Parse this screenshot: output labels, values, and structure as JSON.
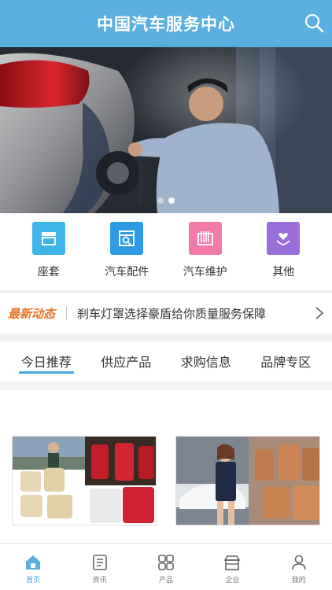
{
  "header": {
    "title": "中国汽车服务中心"
  },
  "banner": {
    "slides": 2,
    "active_index": 0
  },
  "categories": [
    {
      "label": "座套",
      "icon": "seat-cover-icon",
      "color": "#3fb4e6"
    },
    {
      "label": "汽车配件",
      "icon": "parts-search-icon",
      "color": "#2e9ae4"
    },
    {
      "label": "汽车维护",
      "icon": "maintenance-icon",
      "color": "#f27aa8"
    },
    {
      "label": "其他",
      "icon": "heart-hand-icon",
      "color": "#9a6fd9"
    }
  ],
  "news": {
    "badge": "最新动态",
    "text": "刹车灯罩选择豪盾给你质量服务保障"
  },
  "tabs": [
    "今日推荐",
    "供应产品",
    "求购信息",
    "品牌专区"
  ],
  "tabbar": [
    {
      "label": "首页",
      "icon": "home-icon"
    },
    {
      "label": "资讯",
      "icon": "news-icon"
    },
    {
      "label": "产品",
      "icon": "grid-icon"
    },
    {
      "label": "企业",
      "icon": "building-icon"
    },
    {
      "label": "我的",
      "icon": "user-icon"
    }
  ],
  "colors": {
    "primary": "#5aaee0",
    "accent": "#4aa8e0",
    "badge": "#e8742a"
  }
}
